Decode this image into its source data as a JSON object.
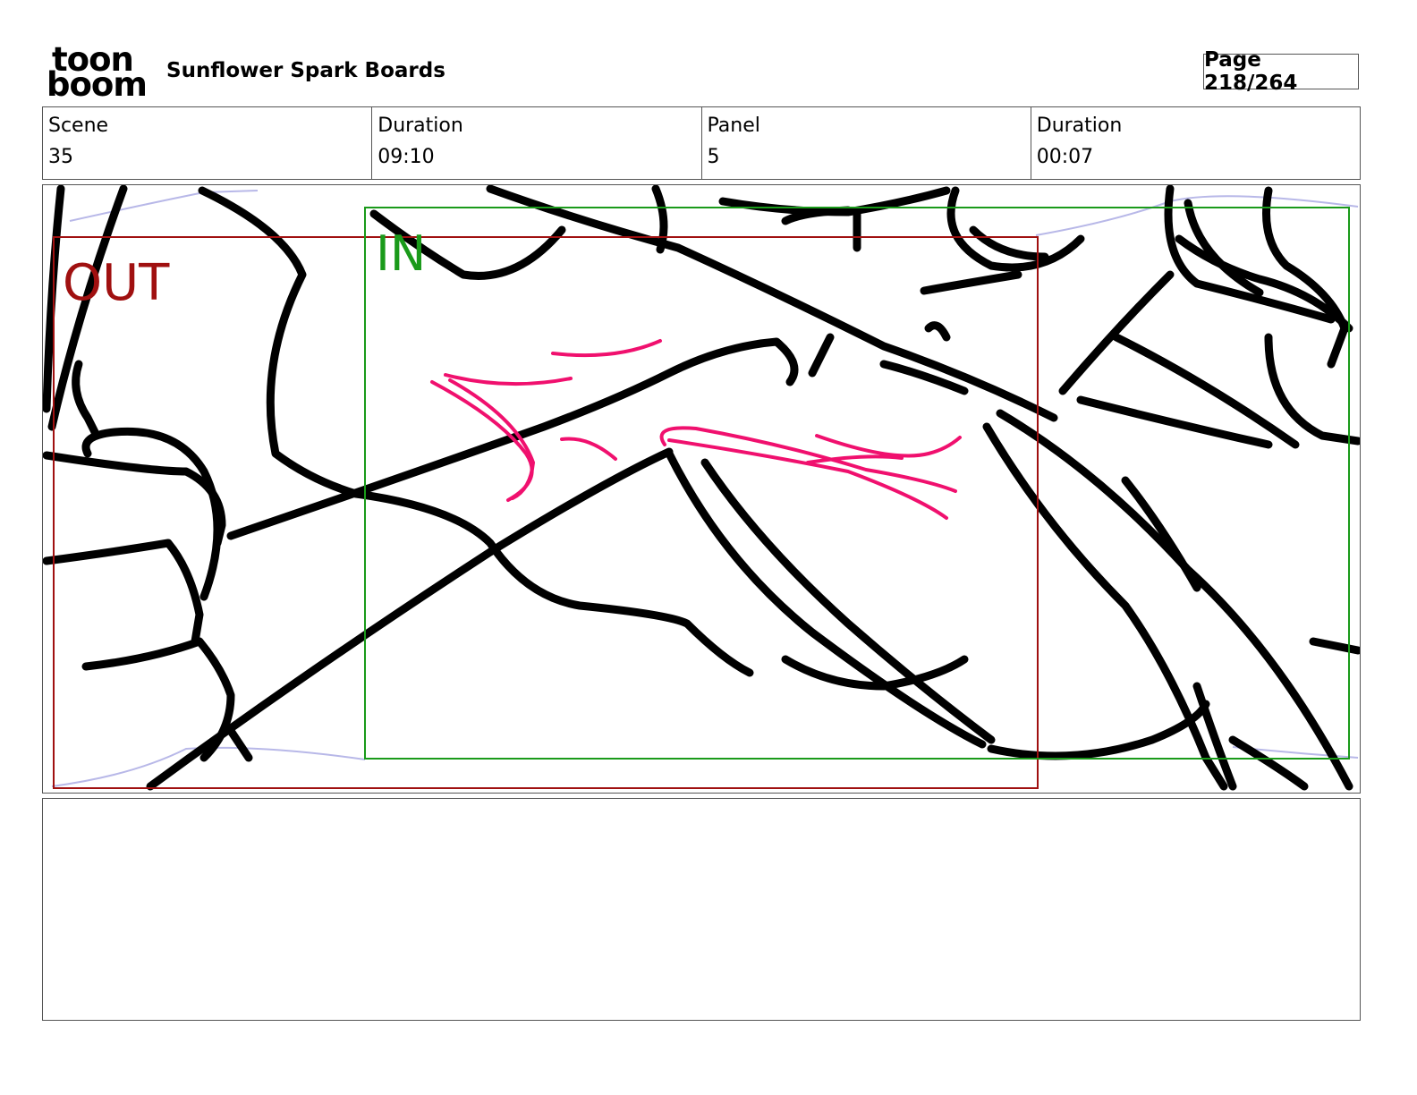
{
  "header": {
    "logo_line1": "toon",
    "logo_line2": "boom",
    "title": "Sunflower Spark Boards",
    "page_label": "Page 218/264"
  },
  "info": {
    "scene_label": "Scene",
    "scene_value": "35",
    "scene_duration_label": "Duration",
    "scene_duration_value": "09:10",
    "panel_label": "Panel",
    "panel_value": "5",
    "panel_duration_label": "Duration",
    "panel_duration_value": "00:07"
  },
  "panel": {
    "out_label": "OUT",
    "in_label": "IN",
    "colors": {
      "out_frame": "#a01010",
      "in_frame": "#1a9a1a",
      "line_art": "#000000",
      "accent_strokes": "#f0106e",
      "camera_path": "#b8b8e8"
    }
  },
  "notes": {
    "text": ""
  }
}
